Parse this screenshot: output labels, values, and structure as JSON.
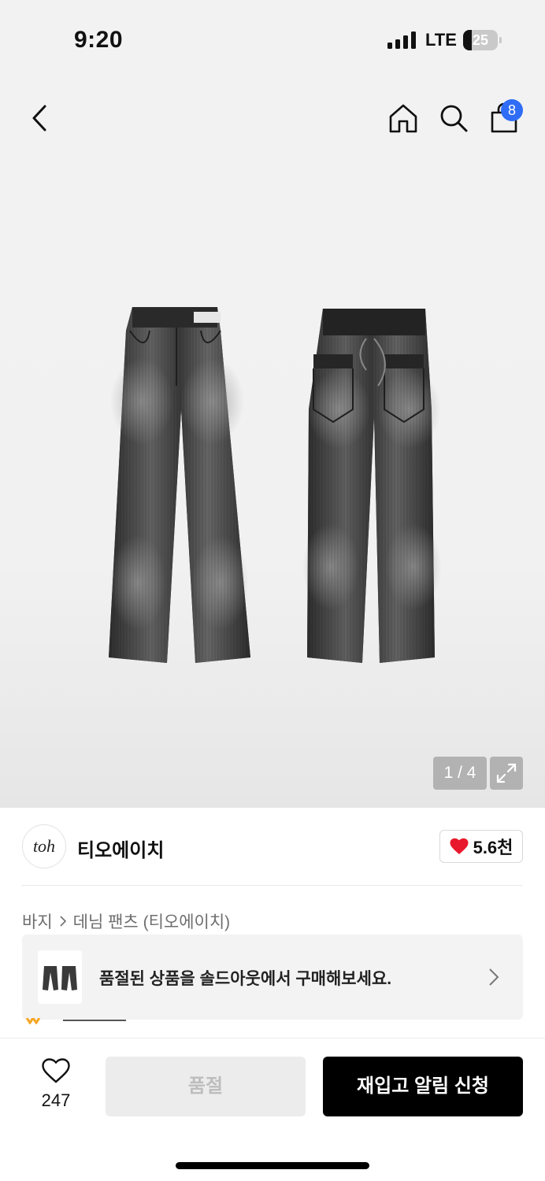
{
  "status_bar": {
    "time": "9:20",
    "network": "LTE",
    "battery": "25",
    "battery_level": 0.25
  },
  "nav": {
    "back_icon": "chevron-left-icon",
    "home_icon": "home-icon",
    "search_icon": "search-icon",
    "cart_icon": "shopping-bag-icon",
    "cart_badge": "8",
    "badge_color": "#2f6df6"
  },
  "gallery": {
    "counter": "1 / 4",
    "expand_icon": "expand-icon"
  },
  "brand": {
    "logo_text": "toh",
    "name": "티오에이치",
    "likes": "5.6천",
    "heart_color": "#e8192c"
  },
  "breadcrumb": {
    "items": [
      "바지",
      "데님 팬츠 (티오에이치)"
    ]
  },
  "soldout_banner": {
    "text": "품절된 상품을 솔드아웃에서 구매해보세요."
  },
  "bottom_bar": {
    "wish_count": "247",
    "soldout_label": "품절",
    "restock_label": "재입고 알림 신청"
  }
}
